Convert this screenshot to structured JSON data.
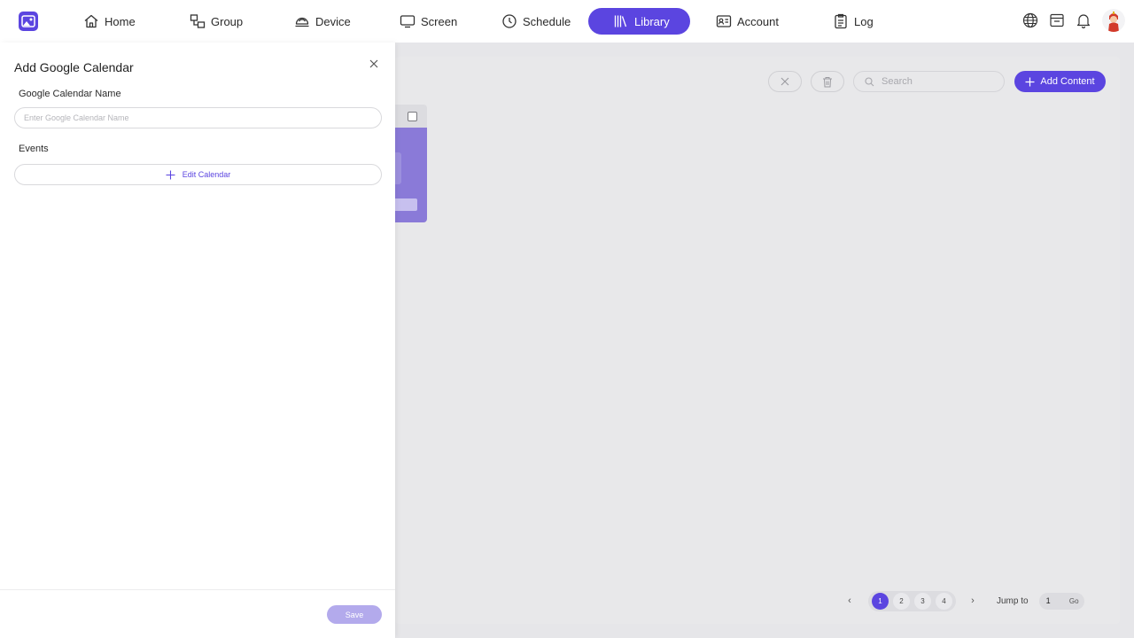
{
  "nav": {
    "items": [
      {
        "label": "Home",
        "icon": "home-icon"
      },
      {
        "label": "Group",
        "icon": "group-icon"
      },
      {
        "label": "Device",
        "icon": "device-icon"
      },
      {
        "label": "Screen",
        "icon": "screen-icon"
      },
      {
        "label": "Schedule",
        "icon": "schedule-icon"
      },
      {
        "label": "Library",
        "icon": "library-icon",
        "active": true
      },
      {
        "label": "Account",
        "icon": "account-icon"
      },
      {
        "label": "Log",
        "icon": "log-icon"
      }
    ],
    "right_icons": [
      "globe-icon",
      "store-icon",
      "bell-icon",
      "avatar"
    ]
  },
  "library": {
    "search_placeholder": "Search",
    "add_content_label": "Add Content",
    "pagination": {
      "pages": [
        "1",
        "2",
        "3",
        "4"
      ],
      "current_page": "1",
      "jump_label": "Jump to",
      "jump_value": "1",
      "go_label": "Go"
    }
  },
  "drawer": {
    "title": "Add Google Calendar",
    "name_label": "Google Calendar Name",
    "name_placeholder": "Enter Google Calendar Name",
    "name_value": "",
    "events_label": "Events",
    "edit_calendar_label": "Edit Calendar",
    "save_label": "Save"
  },
  "colors": {
    "accent": "#5b45e0",
    "accent_disabled": "#b3aaec",
    "overlay": "#e6e6e9"
  }
}
